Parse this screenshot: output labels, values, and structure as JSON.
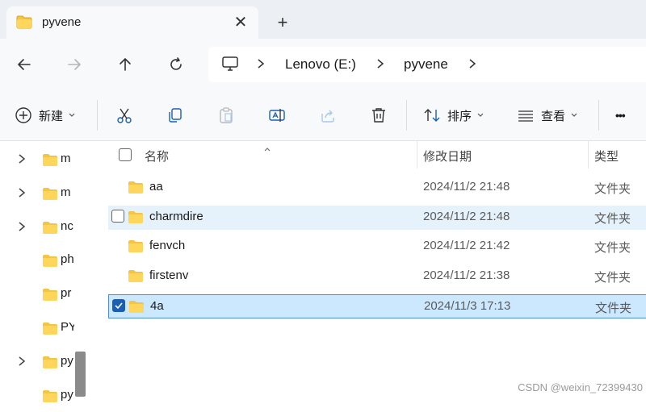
{
  "tab": {
    "title": "pyvene",
    "close_symbol": "✕",
    "new_tab_symbol": "+"
  },
  "address": {
    "breadcrumbs": [
      "Lenovo  (E:)",
      "pyvene"
    ]
  },
  "commands": {
    "new_label": "新建",
    "sort_label": "排序",
    "view_label": "查看",
    "more_symbol": "•••"
  },
  "columns": {
    "name": "名称",
    "date": "修改日期",
    "type": "类型"
  },
  "files": [
    {
      "name": "aa",
      "date": "2024/11/2 21:48",
      "type": "文件夹",
      "state": "normal"
    },
    {
      "name": "charmdire",
      "date": "2024/11/2 21:48",
      "type": "文件夹",
      "state": "hover"
    },
    {
      "name": "fenvch",
      "date": "2024/11/2 21:42",
      "type": "文件夹",
      "state": "normal"
    },
    {
      "name": "firstenv",
      "date": "2024/11/2 21:38",
      "type": "文件夹",
      "state": "normal"
    },
    {
      "name": "4a",
      "date": "2024/11/3 17:13",
      "type": "文件夹",
      "state": "selected"
    }
  ],
  "nav_pane": {
    "items": [
      {
        "label": "m",
        "expandable": true
      },
      {
        "label": "m",
        "expandable": true
      },
      {
        "label": "nc",
        "expandable": true
      },
      {
        "label": "ph",
        "expandable": false
      },
      {
        "label": "pr",
        "expandable": false
      },
      {
        "label": "PY",
        "expandable": false
      },
      {
        "label": "py",
        "expandable": true
      },
      {
        "label": "py",
        "expandable": false
      }
    ]
  },
  "watermark": "CSDN @weixin_72399430",
  "colors": {
    "accent": "#1a5fb4",
    "folder": "#f4c542",
    "selection": "#cce8ff",
    "hover": "#e5f1fb"
  }
}
